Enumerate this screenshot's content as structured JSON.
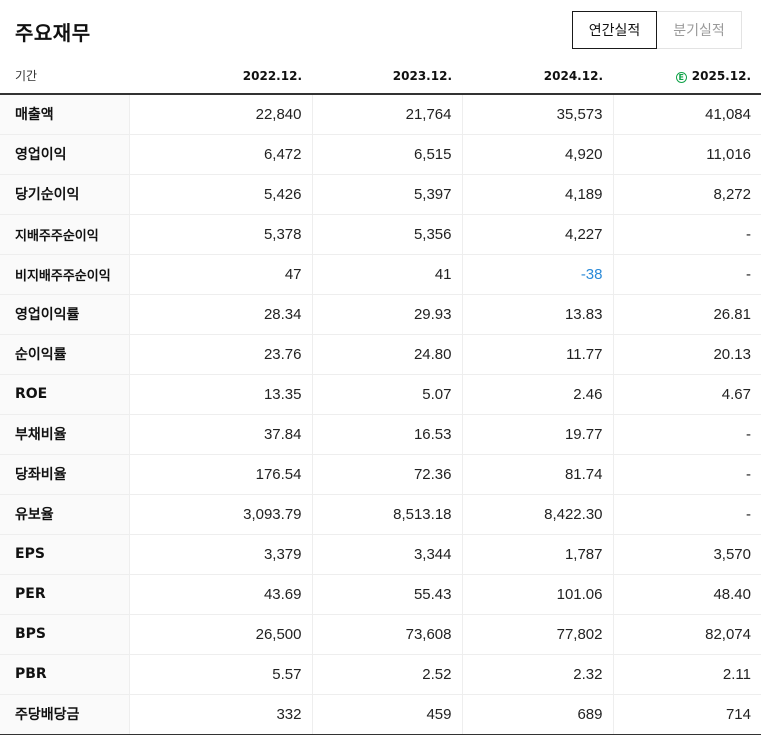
{
  "title": "주요재무",
  "tabs": [
    {
      "label": "연간실적",
      "active": true
    },
    {
      "label": "분기실적",
      "active": false
    }
  ],
  "header": {
    "period_label": "기간",
    "years": [
      "2022.12.",
      "2023.12.",
      "2024.12.",
      "2025.12."
    ],
    "estimate_icon_letter": "E",
    "estimate_icon_color": "#12a34a"
  },
  "rows": [
    {
      "label": "매출액",
      "values": [
        "22,840",
        "21,764",
        "35,573",
        "41,084"
      ]
    },
    {
      "label": "영업이익",
      "values": [
        "6,472",
        "6,515",
        "4,920",
        "11,016"
      ]
    },
    {
      "label": "당기순이익",
      "values": [
        "5,426",
        "5,397",
        "4,189",
        "8,272"
      ]
    },
    {
      "label": "지배주주순이익",
      "values": [
        "5,378",
        "5,356",
        "4,227",
        "-"
      ]
    },
    {
      "label": "비지배주주순이익",
      "values": [
        "47",
        "41",
        "-38",
        "-"
      ]
    },
    {
      "label": "영업이익률",
      "values": [
        "28.34",
        "29.93",
        "13.83",
        "26.81"
      ]
    },
    {
      "label": "순이익률",
      "values": [
        "23.76",
        "24.80",
        "11.77",
        "20.13"
      ]
    },
    {
      "label": "ROE",
      "values": [
        "13.35",
        "5.07",
        "2.46",
        "4.67"
      ]
    },
    {
      "label": "부채비율",
      "values": [
        "37.84",
        "16.53",
        "19.77",
        "-"
      ]
    },
    {
      "label": "당좌비율",
      "values": [
        "176.54",
        "72.36",
        "81.74",
        "-"
      ]
    },
    {
      "label": "유보율",
      "values": [
        "3,093.79",
        "8,513.18",
        "8,422.30",
        "-"
      ]
    },
    {
      "label": "EPS",
      "values": [
        "3,379",
        "3,344",
        "1,787",
        "3,570"
      ]
    },
    {
      "label": "PER",
      "values": [
        "43.69",
        "55.43",
        "101.06",
        "48.40"
      ]
    },
    {
      "label": "BPS",
      "values": [
        "26,500",
        "73,608",
        "77,802",
        "82,074"
      ]
    },
    {
      "label": "PBR",
      "values": [
        "5.57",
        "2.52",
        "2.32",
        "2.11"
      ]
    },
    {
      "label": "주당배당금",
      "values": [
        "332",
        "459",
        "689",
        "714"
      ]
    }
  ],
  "negative_color": "#2a8ad8"
}
